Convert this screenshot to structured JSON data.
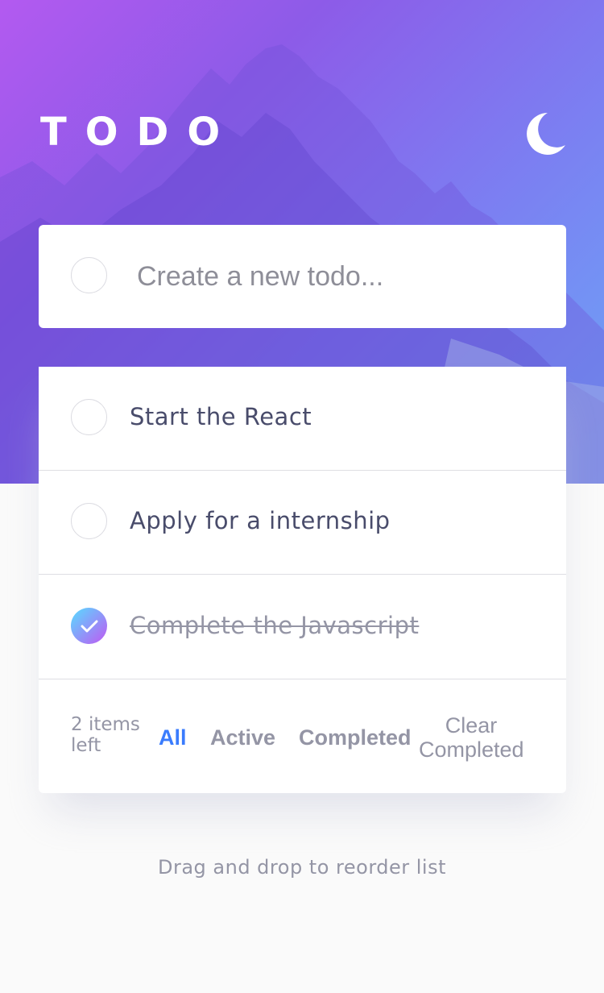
{
  "header": {
    "title": "TODO",
    "theme_icon": "moon-icon"
  },
  "new_todo": {
    "placeholder": "Create a new todo..."
  },
  "todos": [
    {
      "text": "Start the React",
      "completed": false
    },
    {
      "text": "Apply for a internship",
      "completed": false
    },
    {
      "text": "Complete the Javascript",
      "completed": true
    }
  ],
  "footer": {
    "items_left": "2 items left",
    "filters": [
      {
        "label": "All",
        "active": true
      },
      {
        "label": "Active",
        "active": false
      },
      {
        "label": "Completed",
        "active": false
      }
    ],
    "clear_label": "Clear Completed"
  },
  "hint": "Drag and drop to reorder list",
  "colors": {
    "accent": "#3a7cfd",
    "check_gradient_start": "#57ddff",
    "check_gradient_end": "#c058f3",
    "muted_text": "#9495a5",
    "body_text": "#494c6b"
  }
}
